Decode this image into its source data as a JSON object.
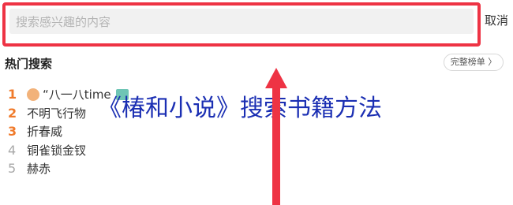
{
  "search": {
    "placeholder": "搜索感兴趣的内容",
    "cancel_label": "取消"
  },
  "hot_search": {
    "title": "热门搜索",
    "full_chart_label": "完整榜单 〉",
    "items": [
      {
        "rank": "1",
        "title": "“八一八time"
      },
      {
        "rank": "2",
        "title": "不明飞行物"
      },
      {
        "rank": "3",
        "title": "折春威"
      },
      {
        "rank": "4",
        "title": "铜雀锁金钗"
      },
      {
        "rank": "5",
        "title": "赫赤"
      }
    ]
  },
  "overlay": {
    "caption": "《椿和小说》搜索书籍方法"
  },
  "colors": {
    "highlight_red": "#ee3344",
    "caption_blue": "#1b2fb3",
    "rank_orange": "#f07a2a",
    "rank_grey": "#a8a8a8"
  },
  "icons": {
    "arrow": "arrow-up-icon",
    "badge": "tag-badge-icon",
    "thumbnail": "book-thumbnail-icon"
  }
}
